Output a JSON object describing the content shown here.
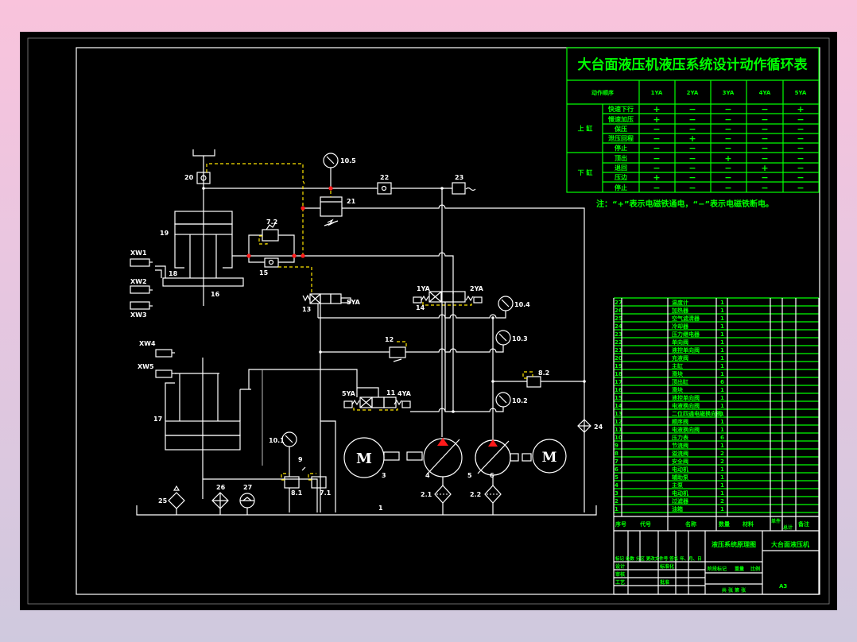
{
  "cycle_table": {
    "title": "大台面液压机液压系统设计动作循环表",
    "header_label": "动作顺序",
    "solenoids": [
      "1YA",
      "2YA",
      "3YA",
      "4YA",
      "5YA"
    ],
    "groups": [
      {
        "name": "上 缸",
        "rows": [
          {
            "action": "快速下行",
            "states": [
              "+",
              "−",
              "−",
              "−",
              "+"
            ]
          },
          {
            "action": "慢速加压",
            "states": [
              "+",
              "−",
              "−",
              "−",
              "−"
            ]
          },
          {
            "action": "保压",
            "states": [
              "−",
              "−",
              "−",
              "−",
              "−"
            ]
          },
          {
            "action": "泄压回程",
            "states": [
              "−",
              "+",
              "−",
              "−",
              "−"
            ]
          },
          {
            "action": "停止",
            "states": [
              "−",
              "−",
              "−",
              "−",
              "−"
            ]
          }
        ]
      },
      {
        "name": "下 缸",
        "rows": [
          {
            "action": "顶出",
            "states": [
              "−",
              "−",
              "+",
              "−",
              "−"
            ]
          },
          {
            "action": "退回",
            "states": [
              "−",
              "−",
              "−",
              "+",
              "−"
            ]
          },
          {
            "action": "压边",
            "states": [
              "+",
              "−",
              "−",
              "−",
              "−"
            ]
          },
          {
            "action": "停止",
            "states": [
              "−",
              "−",
              "−",
              "−",
              "−"
            ]
          }
        ]
      }
    ],
    "note": "注：“+”表示电磁铁通电，“−”表示电磁铁断电。"
  },
  "diagram_labels": {
    "l20": "20",
    "l19": "19",
    "l18": "18",
    "l16": "16",
    "l15": "15",
    "l72": "7.2",
    "l105": "10.5",
    "l21": "21",
    "l22": "22",
    "l23": "23",
    "l13": "13",
    "l5ya_a": "5YA",
    "l14": "14",
    "l1ya": "1YA",
    "l2ya": "2YA",
    "l104": "10.4",
    "l103": "10.3",
    "l12": "12",
    "l82": "8.2",
    "l102": "10.2",
    "l11": "11",
    "l5ya_b": "5YA",
    "l4ya": "4YA",
    "l17": "17",
    "l101": "10.1",
    "l9": "9",
    "l81": "8.1",
    "l71": "7.1",
    "l3": "3",
    "l4": "4",
    "l5": "5",
    "l6": "6",
    "l21f": "2.1",
    "l22f": "2.2",
    "l1": "1",
    "l24": "24",
    "l25": "25",
    "l26": "26",
    "l27": "27",
    "xw1": "XW1",
    "xw2": "XW2",
    "xw3": "XW3",
    "xw4": "XW4",
    "xw5": "XW5",
    "m1": "M",
    "m2": "M"
  },
  "parts_list": [
    {
      "no": "27",
      "name": "温度计",
      "qty": "1"
    },
    {
      "no": "26",
      "name": "加热器",
      "qty": "1"
    },
    {
      "no": "25",
      "name": "空气滤清器",
      "qty": "1"
    },
    {
      "no": "24",
      "name": "冷却器",
      "qty": "1"
    },
    {
      "no": "23",
      "name": "压力继电器",
      "qty": "1"
    },
    {
      "no": "22",
      "name": "单向阀",
      "qty": "1"
    },
    {
      "no": "21",
      "name": "液控单向阀",
      "qty": "1"
    },
    {
      "no": "20",
      "name": "充液阀",
      "qty": "1"
    },
    {
      "no": "19",
      "name": "主缸",
      "qty": "1"
    },
    {
      "no": "18",
      "name": "滑块",
      "qty": "1"
    },
    {
      "no": "17",
      "name": "顶出缸",
      "qty": "6"
    },
    {
      "no": "16",
      "name": "滑块",
      "qty": "1"
    },
    {
      "no": "15",
      "name": "液控单向阀",
      "qty": "1"
    },
    {
      "no": "14",
      "name": "电液换向阀",
      "qty": "1"
    },
    {
      "no": "13",
      "name": "二位四通电磁换向阀",
      "qty": "1"
    },
    {
      "no": "12",
      "name": "顺序阀",
      "qty": "1"
    },
    {
      "no": "11",
      "name": "电液换向阀",
      "qty": "1"
    },
    {
      "no": "10",
      "name": "压力表",
      "qty": "6"
    },
    {
      "no": "9",
      "name": "节流阀",
      "qty": "1"
    },
    {
      "no": "8",
      "name": "溢流阀",
      "qty": "2"
    },
    {
      "no": "7",
      "name": "安全阀",
      "qty": "2"
    },
    {
      "no": "6",
      "name": "电动机",
      "qty": "1"
    },
    {
      "no": "5",
      "name": "辅助泵",
      "qty": "1"
    },
    {
      "no": "4",
      "name": "主泵",
      "qty": "1"
    },
    {
      "no": "3",
      "name": "电动机",
      "qty": "1"
    },
    {
      "no": "2",
      "name": "过滤器",
      "qty": "2"
    },
    {
      "no": "1",
      "name": "油箱",
      "qty": "1"
    }
  ],
  "title_block": {
    "col_headers": [
      "序号",
      "代号",
      "名称",
      "数量",
      "材料",
      "单件",
      "总计",
      "备注"
    ],
    "drawing_name": "液压系统原理图",
    "product_name": "大台面液压机",
    "sign_row": "标记 处数 分区 更改文件号 签名 年、月、日",
    "design": "设计",
    "standard": "标准化",
    "review": "审核",
    "process": "工艺",
    "approve": "批准",
    "stage_mark": "阶段标记",
    "weight": "重量",
    "scale": "比例",
    "sheet": "共 张 第 张",
    "size": "A3"
  }
}
